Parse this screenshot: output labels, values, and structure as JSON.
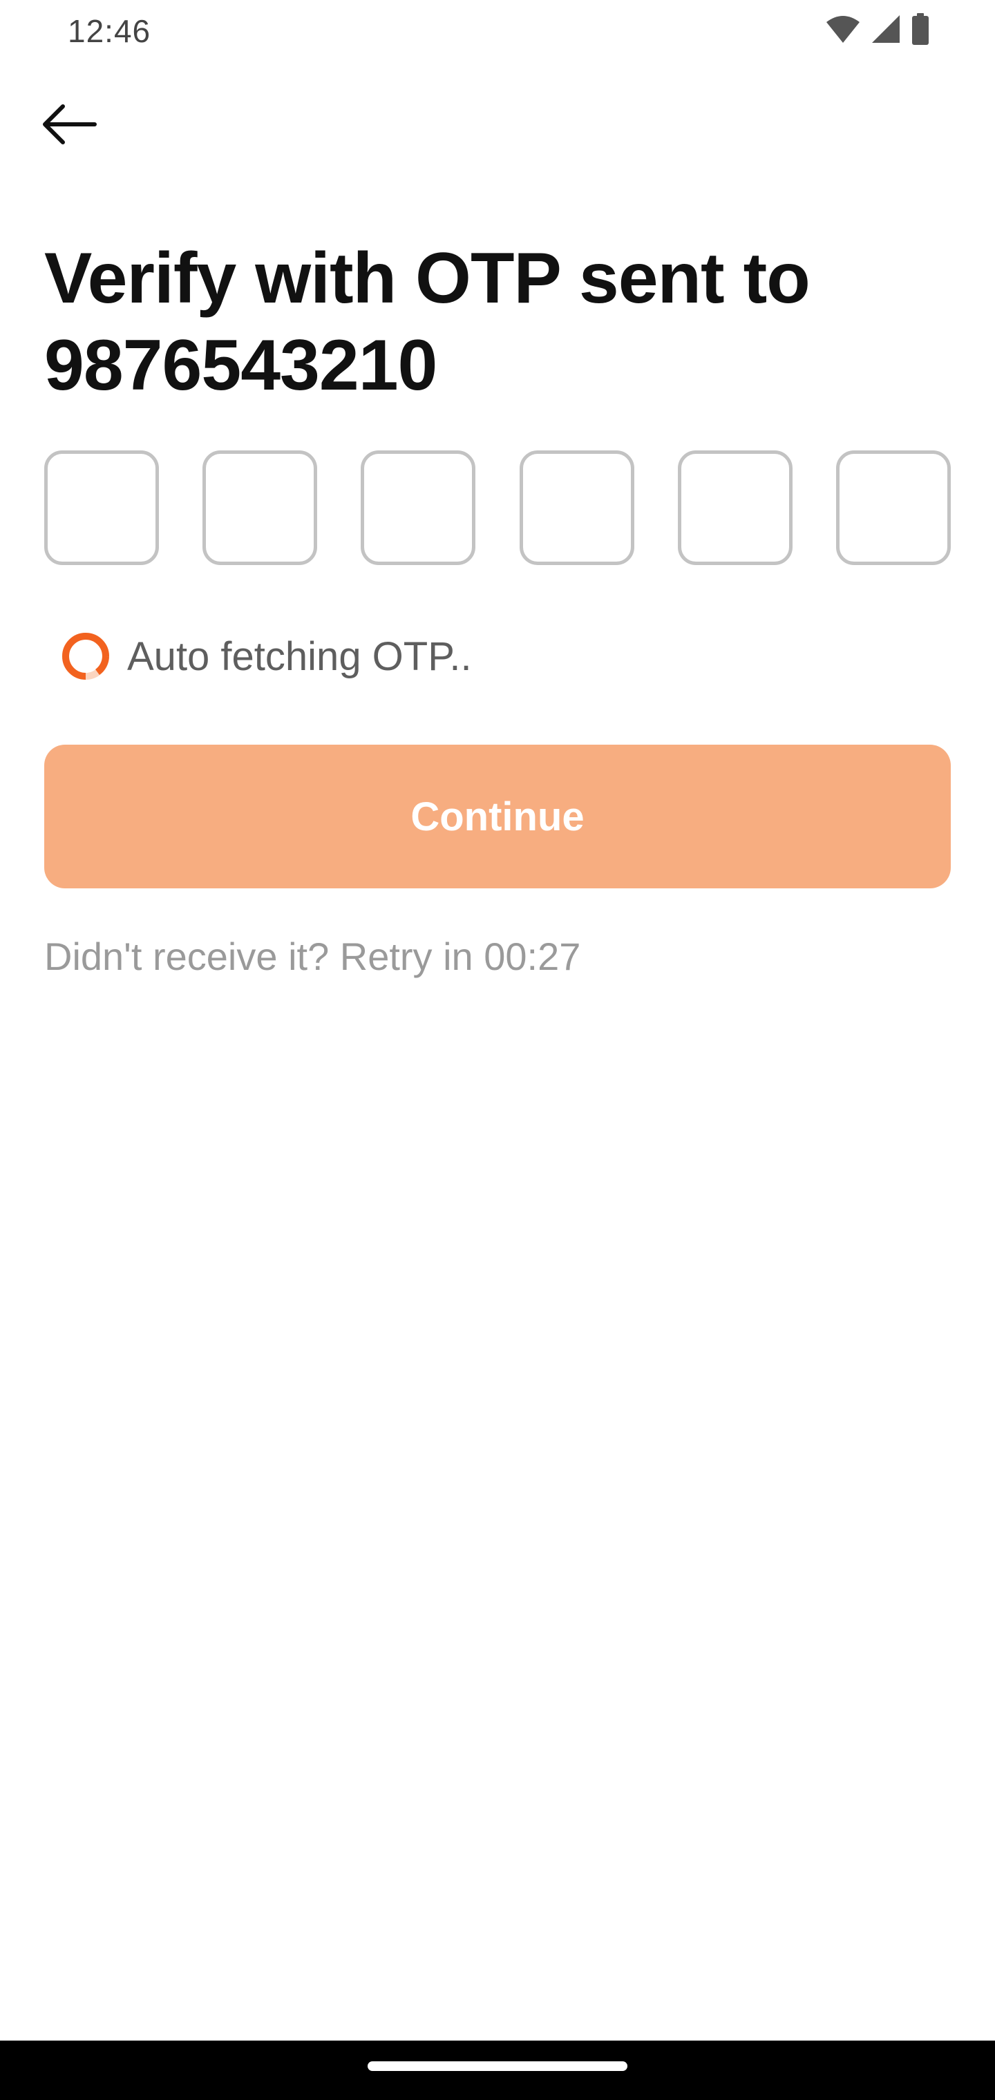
{
  "status_bar": {
    "time": "12:46",
    "icons": [
      "wifi-icon",
      "signal-icon",
      "battery-icon"
    ]
  },
  "header": {
    "back_icon": "arrow-left-icon"
  },
  "main": {
    "title": "Verify with OTP sent to 9876543210",
    "otp_digits": [
      "",
      "",
      "",
      "",
      "",
      ""
    ],
    "auto_fetch_text": "Auto fetching OTP..",
    "continue_label": "Continue",
    "retry_text": "Didn't receive it? Retry in 00:27"
  },
  "colors": {
    "accent": "#f2621f",
    "accent_light": "#f7ad80",
    "otp_border": "#c3c3c3"
  }
}
